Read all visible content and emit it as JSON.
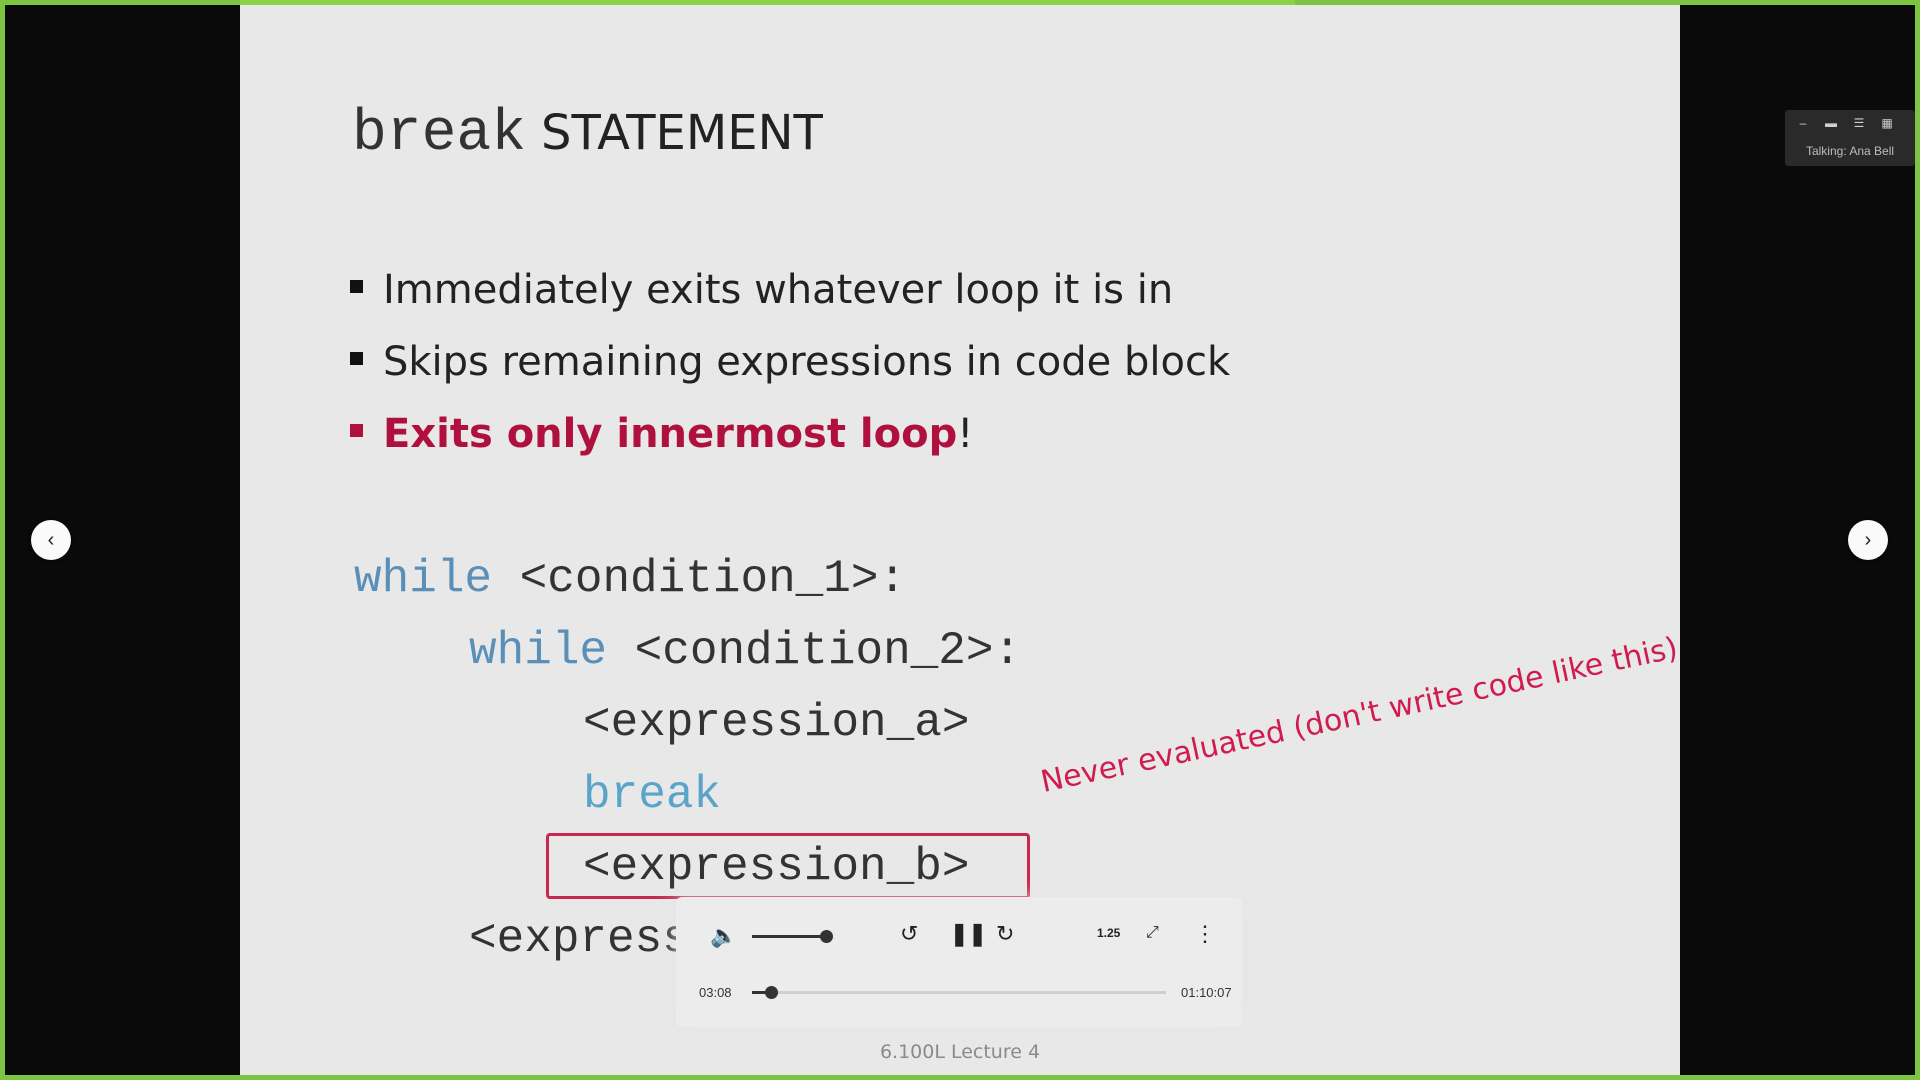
{
  "slide": {
    "title_keyword": "break",
    "title_rest": "STATEMENT",
    "bullets": [
      "Immediately exits whatever loop it is in",
      "Skips remaining expressions in code block",
      "Exits only innermost loop"
    ],
    "bullet3_suffix": "!",
    "code": {
      "line1_kw": "while",
      "line1_rest": " <condition_1>:",
      "line2_kw": "while",
      "line2_rest": " <condition_2>:",
      "line3": "<expression_a>",
      "line4_kw": "break",
      "line5": "<expression_b>",
      "line6": "<expression_c>"
    },
    "annotation": "Never evaluated (don't write code like this)",
    "footer": "6.100L Lecture 4"
  },
  "nav": {
    "prev_icon": "chevron-left-icon",
    "next_icon": "chevron-right-icon"
  },
  "meeting_panel": {
    "label": "Talking: Ana Bell"
  },
  "player": {
    "current_time": "03:08",
    "total_time": "01:10:07",
    "speed": "1.25",
    "volume_fraction": 0.85,
    "progress_fraction": 0.045
  },
  "colors": {
    "frame": "#7cc540",
    "highlight": "#b0103e",
    "annotation": "#d11a4f",
    "keyword": "#5a8fb8"
  }
}
